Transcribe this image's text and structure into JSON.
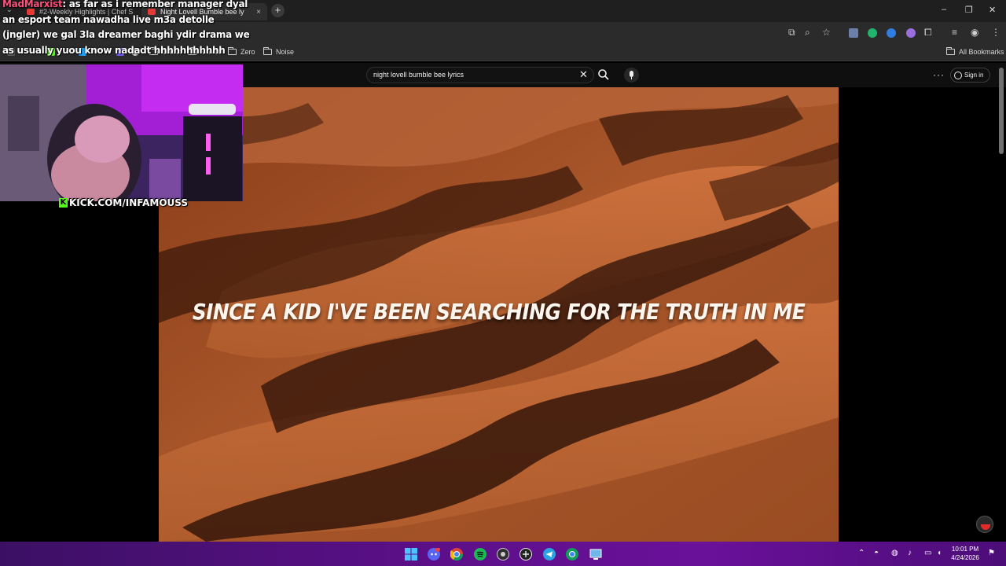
{
  "browser": {
    "tabs": [
      {
        "label": "#2-Weekly Highlights | Chef S",
        "close": "×"
      },
      {
        "label": "Night Lovell Bumble bee ly",
        "close": "×"
      }
    ],
    "new_tab": "+",
    "window_controls": {
      "minimize": "–",
      "maximize": "❐",
      "close": "✕"
    },
    "bookmarks": [
      "Ghost",
      "Moves",
      "Zero",
      "Noise"
    ],
    "all_bookmarks": "All Bookmarks"
  },
  "youtube": {
    "search_query": "night lovell bumble bee lyrics",
    "clear": "✕",
    "more": "···",
    "sign_in": "Sign in"
  },
  "video": {
    "lyric": "SINCE A KID I'VE BEEN SEARCHING FOR THE TRUTH IN ME"
  },
  "stream": {
    "cam_label": "KICK.COM/INFAMOUSS",
    "kick_letter": "K",
    "chat": {
      "username": "MadMarxist",
      "message": ": as far as i remember manager dyal an esport team nawadha live m3a detolle (jngler) we gal 3la dreamer baghi ydir drama we as usually yuou know nadadt hhhhhhhhhhh"
    }
  },
  "taskbar": {
    "time": "10:01 PM",
    "date": "4/24/2026"
  },
  "colors": {
    "chat_username": "#ff4f7b",
    "kick_green": "#53fc18",
    "taskbar": "#5a0f86"
  }
}
